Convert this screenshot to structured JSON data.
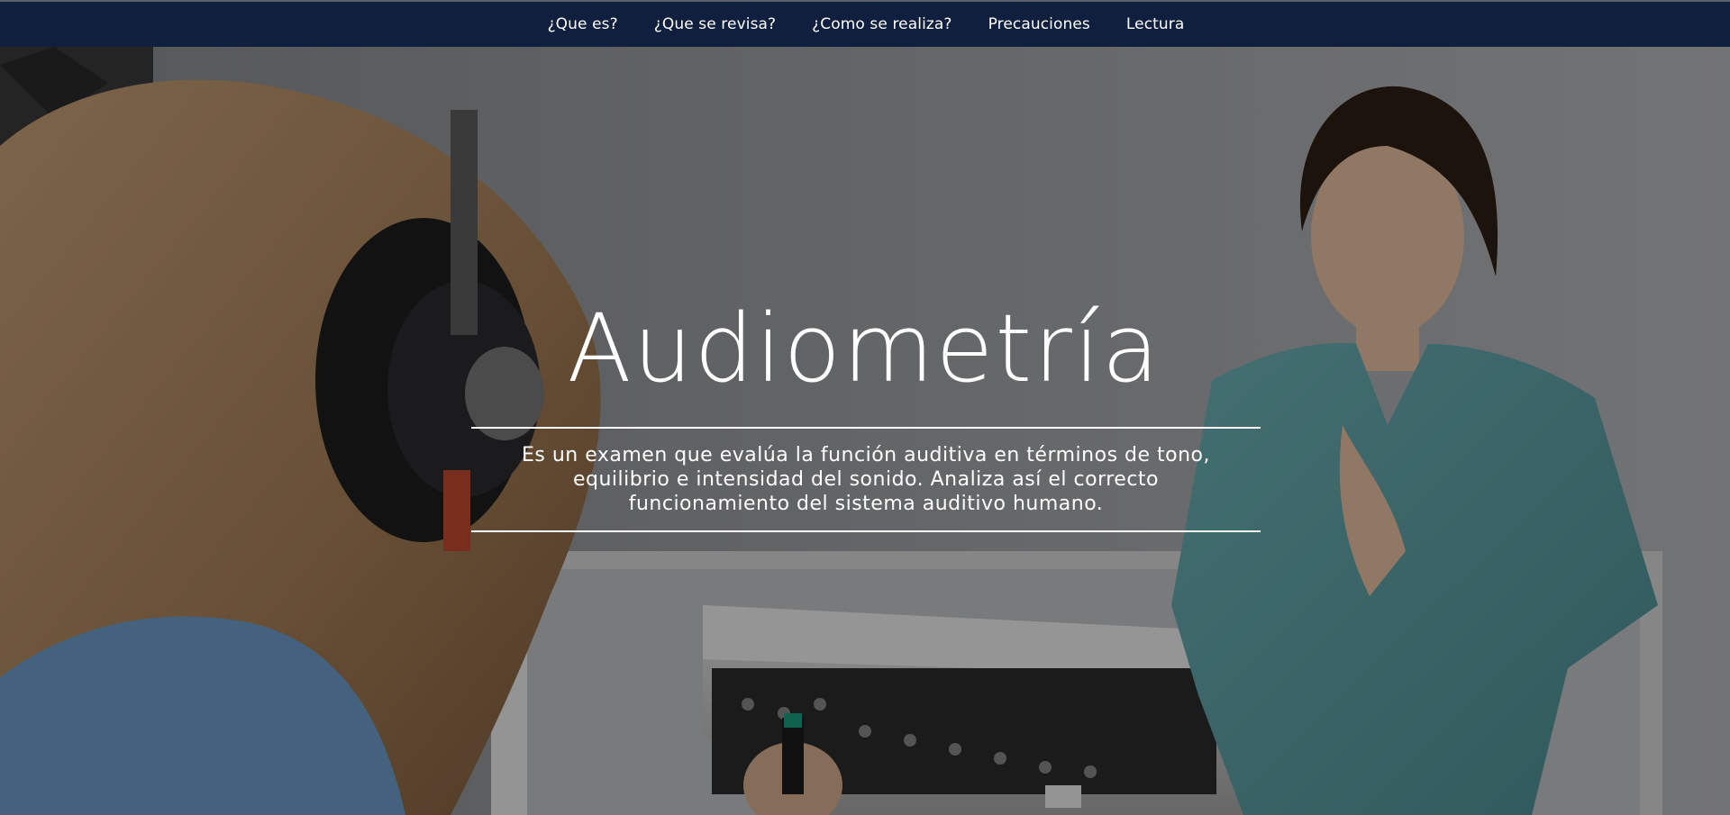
{
  "nav": {
    "items": [
      {
        "label": "¿Que es?"
      },
      {
        "label": "¿Que se revisa?"
      },
      {
        "label": "¿Como se realiza?"
      },
      {
        "label": "Precauciones"
      },
      {
        "label": "Lectura"
      }
    ]
  },
  "hero": {
    "title": "Audiometría",
    "description": "Es un examen que evalúa la función auditiva en términos de tono, equilibrio e intensidad del sonido. Analiza así el correcto funcionamiento del sistema auditivo humano."
  },
  "colors": {
    "navbar_bg": "#0f1f3d",
    "text": "#ffffff",
    "scrubs": "#5aa0a5"
  }
}
